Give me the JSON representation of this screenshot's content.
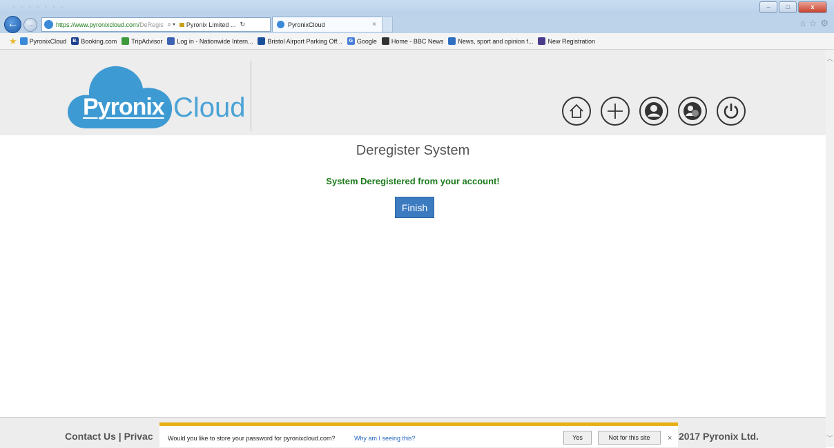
{
  "browser": {
    "address": {
      "url_main": "https://www.pyronixcloud.com/",
      "url_rest": "DeRegis",
      "security_label": "Pyronix Limited ..."
    },
    "tab": {
      "title": "PyronixCloud"
    },
    "favorites": [
      {
        "label": "PyronixCloud",
        "color": "#3b8ad8"
      },
      {
        "label": "Booking.com",
        "color": "#1d3f8f",
        "letter": "B."
      },
      {
        "label": "TripAdvisor",
        "color": "#3c9a3c"
      },
      {
        "label": "Log in - Nationwide Intern...",
        "color": "#3d62b3"
      },
      {
        "label": "Bristol Airport Parking Off...",
        "color": "#1b4f9b"
      },
      {
        "label": "Google",
        "color": "#4a7fd8",
        "letter": "G"
      },
      {
        "label": "Home - BBC News",
        "color": "#333333"
      },
      {
        "label": "News, sport and opinion f...",
        "color": "#2f6fc2"
      },
      {
        "label": "New Registration",
        "color": "#4a3a8a"
      }
    ]
  },
  "header": {
    "logo_badge": "Pyronix",
    "logo_word": "Cloud",
    "icons": [
      "home-icon",
      "add-icon",
      "account-icon",
      "users-icon",
      "power-icon"
    ]
  },
  "main": {
    "title": "Deregister System",
    "message": "System Deregistered from your account!",
    "finish_label": "Finish"
  },
  "footer": {
    "left": "Contact Us | Privac",
    "right": "2017 Pyronix Ltd."
  },
  "notification": {
    "text": "Would you like to store your password for pyronixcloud.com?",
    "link": "Why am I seeing this?",
    "yes": "Yes",
    "no": "Not for this site",
    "close": "×"
  },
  "colors": {
    "accent_blue": "#3c7bc0",
    "success_green": "#1c7a1c",
    "logo_blue": "#4aa3d6",
    "notify_bar": "#e6b117"
  }
}
